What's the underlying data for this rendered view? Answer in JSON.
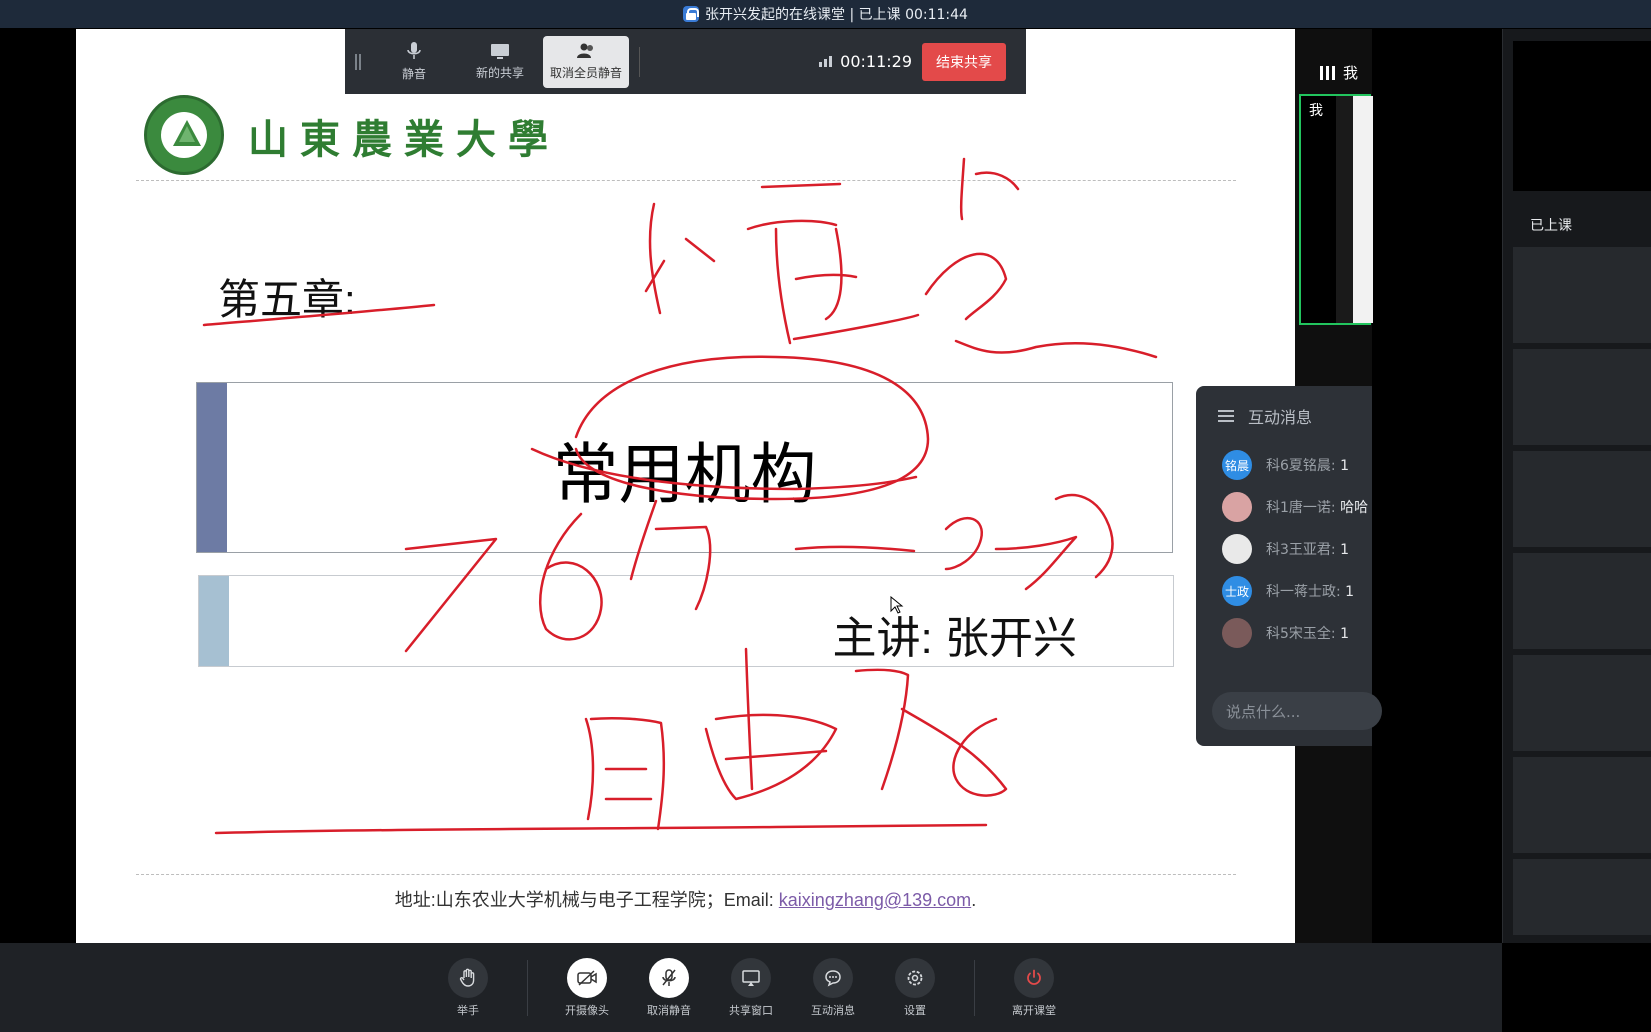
{
  "window": {
    "title": "张开兴发起的在线课堂 | 已上课 00:11:44"
  },
  "slide": {
    "school_name": "山東農業大學",
    "chapter": "第五章:",
    "title": "常用机构",
    "lecturer": "主讲: 张开兴",
    "address_prefix": "地址:山东农业大学机械与电子工程学院；Email: ",
    "email": "kaixingzhang@139.com",
    "address_suffix": "."
  },
  "share_toolbar": {
    "mute_label": "静音",
    "new_share_label": "新的共享",
    "unmute_all_label": "取消全员静音",
    "timer": "00:11:29",
    "end_share_label": "结束共享"
  },
  "video": {
    "header_label": "我",
    "self_label": "我"
  },
  "chat": {
    "title": "互动消息",
    "messages": [
      {
        "avatar": "铭晨",
        "name": "科6夏铭晨:",
        "text": "1",
        "avatar_color": "#2f8de4"
      },
      {
        "avatar": "",
        "name": "科1唐一诺:",
        "text": "哈哈",
        "avatar_color": "#d9a3a3"
      },
      {
        "avatar": "",
        "name": "科3王亚君:",
        "text": "1",
        "avatar_color": "#e9e9e9"
      },
      {
        "avatar": "士政",
        "name": "科一蒋士政:",
        "text": "1",
        "avatar_color": "#2f8de4"
      },
      {
        "avatar": "",
        "name": "科5宋玉全:",
        "text": "1",
        "avatar_color": "#7a5a5a"
      }
    ],
    "input_placeholder": "说点什么..."
  },
  "sidebar": {
    "status": "已上课"
  },
  "bottom_bar": {
    "raise_hand": "举手",
    "camera": "开摄像头",
    "unmute": "取消静音",
    "share_window": "共享窗口",
    "messages": "互动消息",
    "settings": "设置",
    "leave": "离开课堂"
  },
  "colors": {
    "ink": "#d81e2a",
    "end_button": "#e34a4a",
    "accent_green": "#22c55e"
  }
}
